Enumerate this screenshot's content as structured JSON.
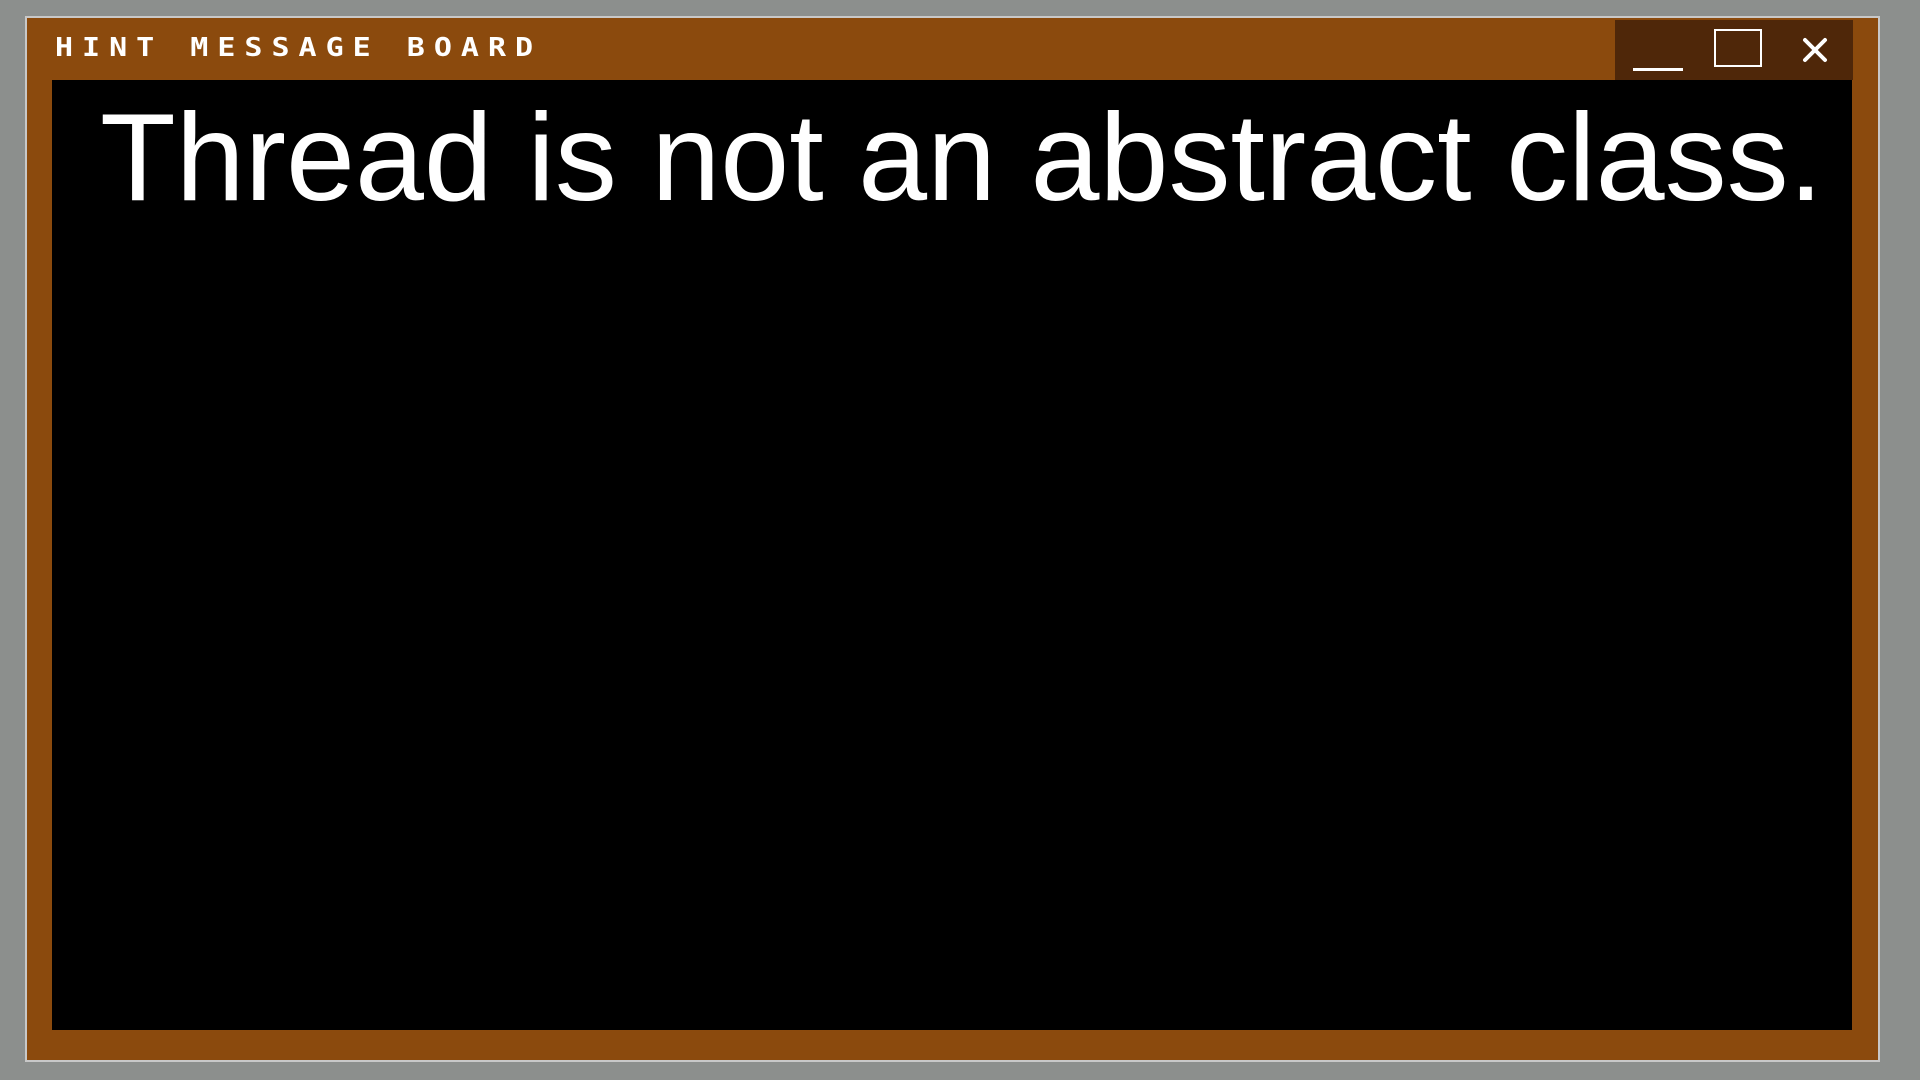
{
  "window": {
    "title": "HINT MESSAGE BOARD",
    "controls": {
      "minimize": "minimize-icon",
      "maximize": "maximize-icon",
      "close": "close-icon"
    }
  },
  "content": {
    "message": "Thread is not an abstract class."
  },
  "colors": {
    "desktop_background": "#8c8f8d",
    "window_frame": "#8b4a0d",
    "controls_background": "#4f2709",
    "content_background": "#000000",
    "text": "#ffffff"
  }
}
